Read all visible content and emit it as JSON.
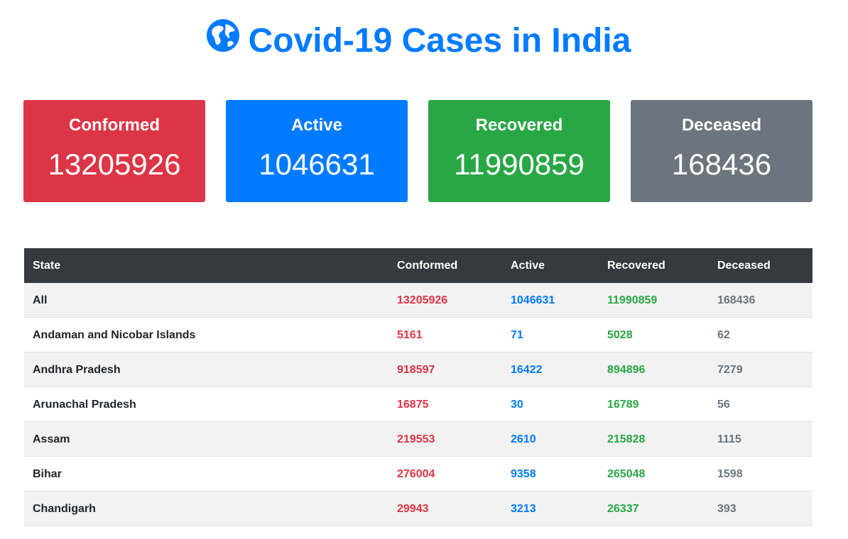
{
  "header": {
    "title": "Covid-19 Cases in India",
    "icon": "globe-icon",
    "color": "#007bff"
  },
  "cards": [
    {
      "label": "Conformed",
      "value": "13205926",
      "color": "#dc3545"
    },
    {
      "label": "Active",
      "value": "1046631",
      "color": "#007bff"
    },
    {
      "label": "Recovered",
      "value": "11990859",
      "color": "#28a745"
    },
    {
      "label": "Deceased",
      "value": "168436",
      "color": "#6c757d"
    }
  ],
  "table": {
    "columns": [
      "State",
      "Conformed",
      "Active",
      "Recovered",
      "Deceased"
    ],
    "rows": [
      [
        "All",
        "13205926",
        "1046631",
        "11990859",
        "168436"
      ],
      [
        "Andaman and Nicobar Islands",
        "5161",
        "71",
        "5028",
        "62"
      ],
      [
        "Andhra Pradesh",
        "918597",
        "16422",
        "894896",
        "7279"
      ],
      [
        "Arunachal Pradesh",
        "16875",
        "30",
        "16789",
        "56"
      ],
      [
        "Assam",
        "219553",
        "2610",
        "215828",
        "1115"
      ],
      [
        "Bihar",
        "276004",
        "9358",
        "265048",
        "1598"
      ],
      [
        "Chandigarh",
        "29943",
        "3213",
        "26337",
        "393"
      ]
    ]
  }
}
